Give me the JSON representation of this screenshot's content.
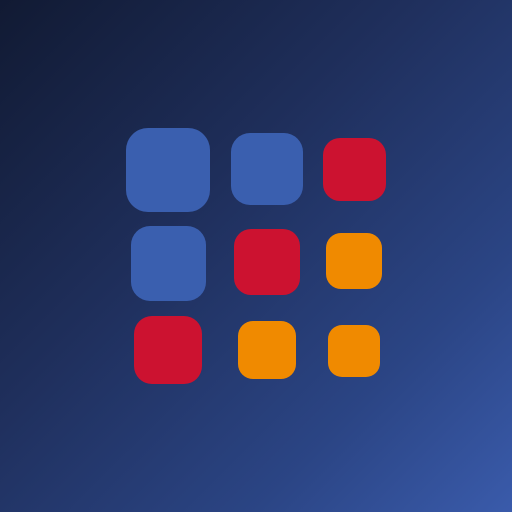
{
  "icon": {
    "colors": {
      "blue": "#3a5faf",
      "red": "#cc1230",
      "orange": "#f08a00"
    },
    "grid": [
      [
        "blue",
        "blue",
        "red"
      ],
      [
        "blue",
        "red",
        "orange"
      ],
      [
        "red",
        "orange",
        "orange"
      ]
    ]
  }
}
